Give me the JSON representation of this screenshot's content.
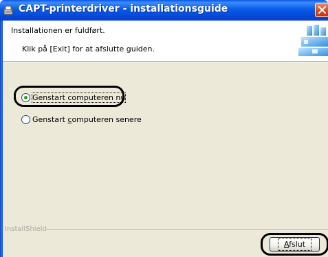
{
  "window": {
    "title": "CAPT-printerdriver - installationsguide"
  },
  "header": {
    "line1": "Installationen er fuldført.",
    "line2": "Klik på [Exit] for at afslutte guiden."
  },
  "options": {
    "restart_now": {
      "label": "Genstart computeren nu",
      "selected": true
    },
    "restart_later_pre": "Genstart ",
    "restart_later_key": "c",
    "restart_later_post": "omputeren senere",
    "restart_later_selected": false
  },
  "footer": {
    "brand": "InstallShield",
    "finish_label_key": "A",
    "finish_label_rest": "fslut"
  },
  "colors": {
    "titlebar": "#0a58e3",
    "dialog_bg": "#ece9d8",
    "radio_dot": "#21a121",
    "close_button": "#d6461b"
  }
}
